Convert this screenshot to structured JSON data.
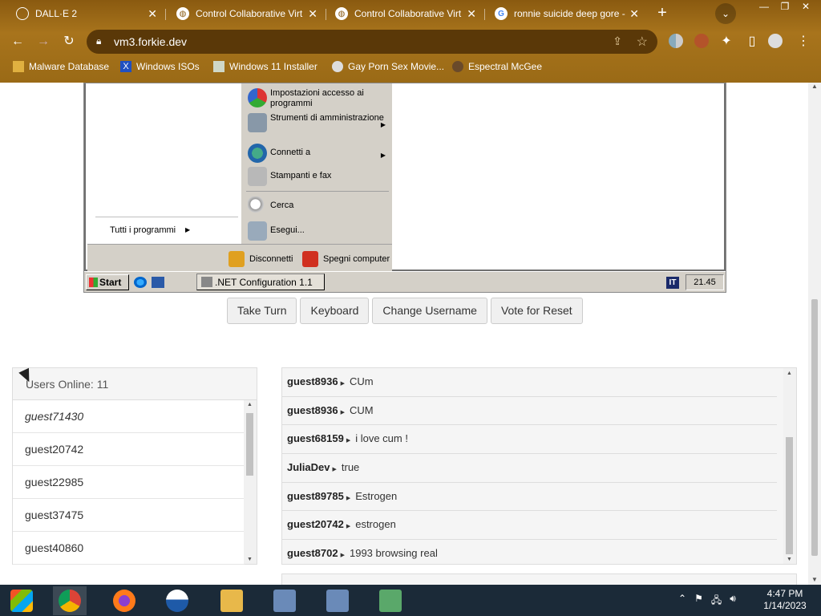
{
  "browser": {
    "tabs": [
      {
        "label": "DALL·E 2",
        "icon": "openai-icon"
      },
      {
        "label": "Control Collaborative Virt",
        "icon": "globe-icon"
      },
      {
        "label": "Control Collaborative Virt",
        "icon": "globe-icon"
      },
      {
        "label": "ronnie suicide deep gore -",
        "icon": "google-icon"
      }
    ],
    "url": "vm3.forkie.dev",
    "bookmarks": [
      {
        "label": "Malware Database"
      },
      {
        "label": "Windows ISOs"
      },
      {
        "label": "Windows 11 Installer"
      },
      {
        "label": "Gay Porn Sex Movie..."
      },
      {
        "label": "Espectral McGee"
      }
    ]
  },
  "vm": {
    "start_menu": {
      "right_items": [
        {
          "label": "Impostazioni accesso ai programmi",
          "icon": "program-access-icon",
          "submenu": false
        },
        {
          "label": "Strumenti di amministrazione",
          "icon": "admin-tools-icon",
          "submenu": true
        },
        {
          "label": "Connetti a",
          "icon": "connect-icon",
          "submenu": true
        },
        {
          "label": "Stampanti e fax",
          "icon": "printer-icon",
          "submenu": false
        },
        {
          "label": "Cerca",
          "icon": "search-icon",
          "submenu": false
        },
        {
          "label": "Esegui...",
          "icon": "run-icon",
          "submenu": false
        }
      ],
      "all_programs": "Tutti i programmi",
      "logoff": "Disconnetti",
      "shutdown": "Spegni computer"
    },
    "taskbar": {
      "start_label": "Start",
      "task_item": ".NET Configuration 1.1",
      "lang": "IT",
      "clock": "21.45"
    }
  },
  "actions": {
    "take_turn": "Take Turn",
    "keyboard": "Keyboard",
    "change_username": "Change Username",
    "vote_reset": "Vote for Reset"
  },
  "users": {
    "header": "Users Online: 11",
    "list": [
      "guest71430",
      "guest20742",
      "guest22985",
      "guest37475",
      "guest40860"
    ]
  },
  "chat": {
    "messages": [
      {
        "user": "guest8936",
        "text": "CUm"
      },
      {
        "user": "guest8936",
        "text": "CUM"
      },
      {
        "user": "guest68159",
        "text": "i love cum !"
      },
      {
        "user": "JuliaDev",
        "text": "true"
      },
      {
        "user": "guest89785",
        "text": "Estrogen"
      },
      {
        "user": "guest20742",
        "text": "estrogen"
      },
      {
        "user": "guest8702",
        "text": "1993 browsing real"
      }
    ]
  },
  "os_taskbar": {
    "time": "4:47 PM",
    "date": "1/14/2023"
  }
}
